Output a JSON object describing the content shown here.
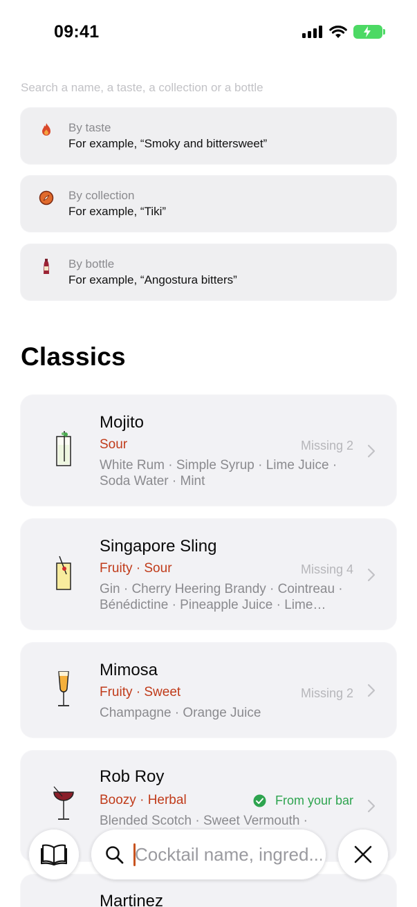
{
  "status_bar": {
    "time": "09:41"
  },
  "search": {
    "hint": "Search a name, a taste, a collection or a bottle",
    "placeholder": "Cocktail name, ingred..."
  },
  "search_options": [
    {
      "title": "By taste",
      "example": "For example, “Smoky and bittersweet”",
      "icon": "flame-icon"
    },
    {
      "title": "By collection",
      "example": "For example, “Tiki”",
      "icon": "compass-icon"
    },
    {
      "title": "By bottle",
      "example": "For example, “Angostura bitters”",
      "icon": "bottle-icon"
    }
  ],
  "section": {
    "title": "Classics"
  },
  "cocktails": [
    {
      "name": "Mojito",
      "tags": "Sour",
      "status": "Missing 2",
      "ingredients": "White Rum · Simple Syrup · Lime Juice · Soda Water · Mint",
      "glass": "highball-glass-icon"
    },
    {
      "name": "Singapore Sling",
      "tags": "Fruity · Sour",
      "status": "Missing 4",
      "ingredients": "Gin · Cherry Heering Brandy · Cointreau · Bénédictine · Pineapple Juice · Lime…",
      "glass": "sling-glass-icon"
    },
    {
      "name": "Mimosa",
      "tags": "Fruity · Sweet",
      "status": "Missing 2",
      "ingredients": "Champagne · Orange Juice",
      "glass": "flute-glass-icon"
    },
    {
      "name": "Rob Roy",
      "tags": "Boozy · Herbal",
      "status": "From your bar",
      "ingredients": "Blended Scotch · Sweet Vermouth ·",
      "glass": "coupe-glass-icon"
    },
    {
      "name": "Martinez",
      "tags": "",
      "status": "",
      "ingredients": "",
      "glass": ""
    }
  ],
  "colors": {
    "accent": "#c03b1a",
    "available": "#2ea44f",
    "card": "#f2f2f5",
    "muted": "#8a8a8e"
  },
  "bottom_bar": {
    "left_icon": "book-icon",
    "right_icon": "close-icon"
  }
}
